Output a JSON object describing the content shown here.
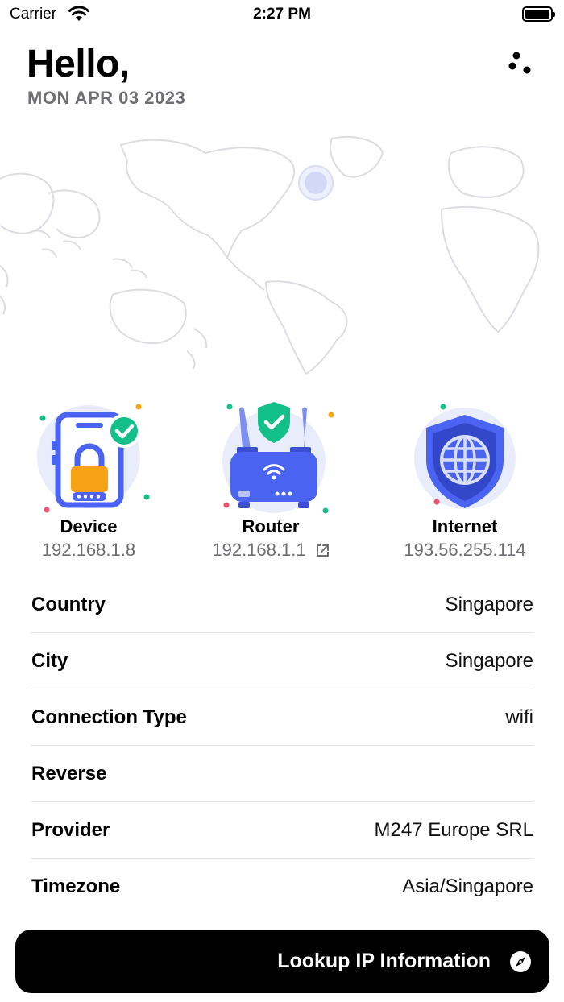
{
  "status_bar": {
    "carrier": "Carrier",
    "time": "2:27 PM"
  },
  "header": {
    "greeting": "Hello,",
    "date": "MON APR 03 2023"
  },
  "nodes": {
    "device": {
      "label": "Device",
      "ip": "192.168.1.8"
    },
    "router": {
      "label": "Router",
      "ip": "192.168.1.1"
    },
    "internet": {
      "label": "Internet",
      "ip": "193.56.255.114"
    }
  },
  "info": {
    "country": {
      "key": "Country",
      "value": "Singapore"
    },
    "city": {
      "key": "City",
      "value": "Singapore"
    },
    "connection_type": {
      "key": "Connection Type",
      "value": "wifi"
    },
    "reverse": {
      "key": "Reverse",
      "value": ""
    },
    "provider": {
      "key": "Provider",
      "value": "M247 Europe SRL"
    },
    "timezone": {
      "key": "Timezone",
      "value": "Asia/Singapore"
    }
  },
  "lookup_button": {
    "label": "Lookup IP Information"
  },
  "icons": {
    "menu": "dots-icon",
    "external": "external-link-icon",
    "button": "compass-icon"
  },
  "colors": {
    "accent_blue": "#4a63f0",
    "green_check": "#13c08a",
    "lock_orange": "#f5a214",
    "muted_text": "#6e6e73"
  }
}
